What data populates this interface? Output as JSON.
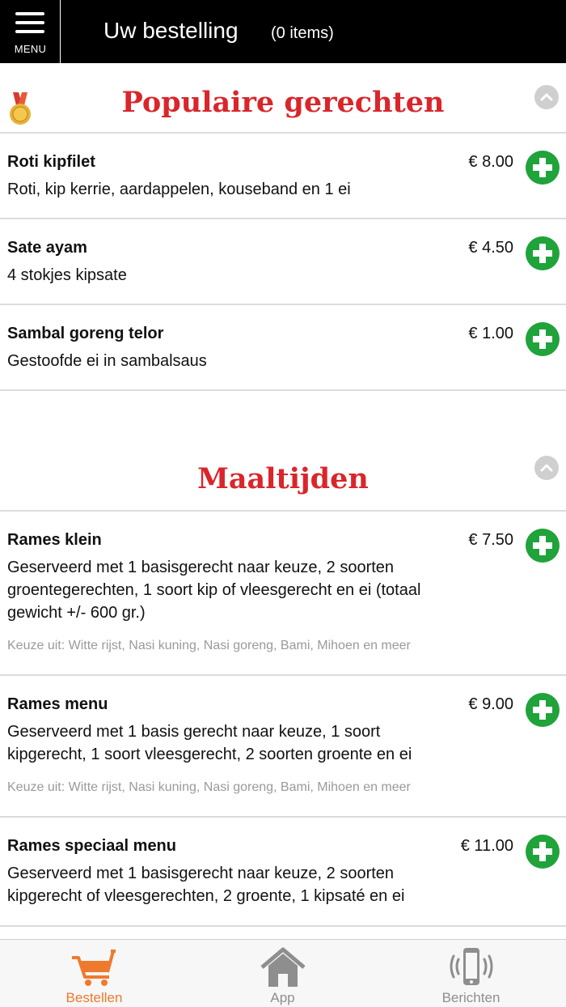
{
  "header": {
    "menu_label": "MENU",
    "title": "Uw bestelling",
    "item_count": "(0 items)"
  },
  "sections": [
    {
      "title": "Populaire gerechten",
      "items": [
        {
          "name": "Roti kipfilet",
          "description": "Roti, kip kerrie, aardappelen, kouseband en 1 ei",
          "price": "€ 8.00"
        },
        {
          "name": "Sate ayam",
          "description": "4 stokjes kipsate",
          "price": "€ 4.50"
        },
        {
          "name": "Sambal goreng telor",
          "description": "Gestoofde ei in sambalsaus",
          "price": "€ 1.00"
        }
      ]
    },
    {
      "title": "Maaltijden",
      "items": [
        {
          "name": "Rames klein",
          "description": "Geserveerd met 1 basisgerecht naar keuze, 2 soorten groentegerechten, 1 soort kip of vleesgerecht en ei (totaal gewicht +/- 600 gr.)",
          "note": "Keuze uit: Witte rijst, Nasi kuning, Nasi goreng, Bami, Mihoen en meer",
          "price": "€ 7.50"
        },
        {
          "name": "Rames menu",
          "description": "Geserveerd met 1 basis gerecht naar keuze, 1 soort kipgerecht, 1 soort vleesgerecht, 2 soorten groente en ei",
          "note": "Keuze uit: Witte rijst, Nasi kuning, Nasi goreng, Bami, Mihoen en meer",
          "price": "€ 9.00"
        },
        {
          "name": "Rames speciaal menu",
          "description": "Geserveerd met 1 basisgerecht naar keuze, 2 soorten kipgerecht of vleesgerechten, 2 groente, 1 kipsaté en ei",
          "price": "€ 11.00"
        }
      ]
    }
  ],
  "tabs": [
    {
      "label": "Bestellen",
      "icon": "cart-icon",
      "active": true
    },
    {
      "label": "App",
      "icon": "home-icon",
      "active": false
    },
    {
      "label": "Berichten",
      "icon": "phone-vibrate-icon",
      "active": false
    }
  ],
  "colors": {
    "section_title": "#d9262b",
    "add_button": "#1fa33a",
    "active_tab": "#ef7a2d",
    "inactive_tab": "#8e8e8e"
  }
}
